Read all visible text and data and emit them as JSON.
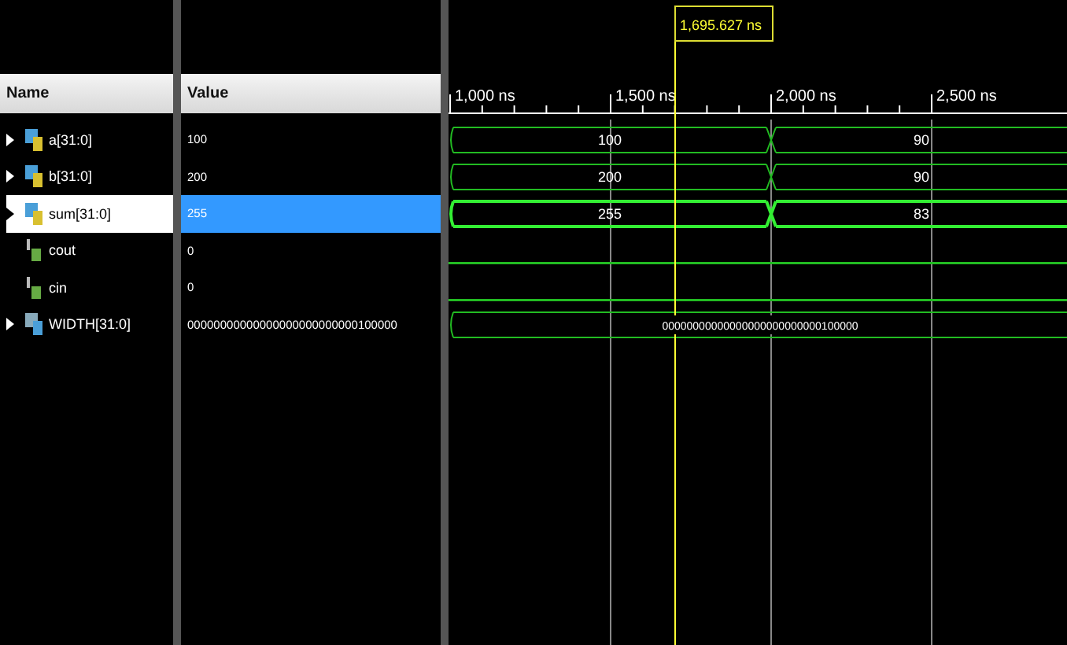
{
  "columns": {
    "name": "Name",
    "value": "Value"
  },
  "cursor": {
    "label": "1,695.627 ns"
  },
  "timeline": {
    "ticks": [
      "1,000 ns",
      "1,500 ns",
      "2,000 ns",
      "2,500 ns"
    ]
  },
  "signals": [
    {
      "name": "a[31:0]",
      "value": "100",
      "kind": "bus",
      "expandable": true,
      "selected": false,
      "segments": [
        "100",
        "90"
      ]
    },
    {
      "name": "b[31:0]",
      "value": "200",
      "kind": "bus",
      "expandable": true,
      "selected": false,
      "segments": [
        "200",
        "90"
      ]
    },
    {
      "name": "sum[31:0]",
      "value": "255",
      "kind": "bus",
      "expandable": true,
      "selected": true,
      "segments": [
        "255",
        "83"
      ]
    },
    {
      "name": "cout",
      "value": "0",
      "kind": "bit",
      "expandable": false,
      "selected": false
    },
    {
      "name": "cin",
      "value": "0",
      "kind": "bit",
      "expandable": false,
      "selected": false
    },
    {
      "name": "WIDTH[31:0]",
      "value": "00000000000000000000000000100000",
      "kind": "param",
      "expandable": true,
      "selected": false,
      "segments": [
        "00000000000000000000000000100000"
      ]
    }
  ]
}
